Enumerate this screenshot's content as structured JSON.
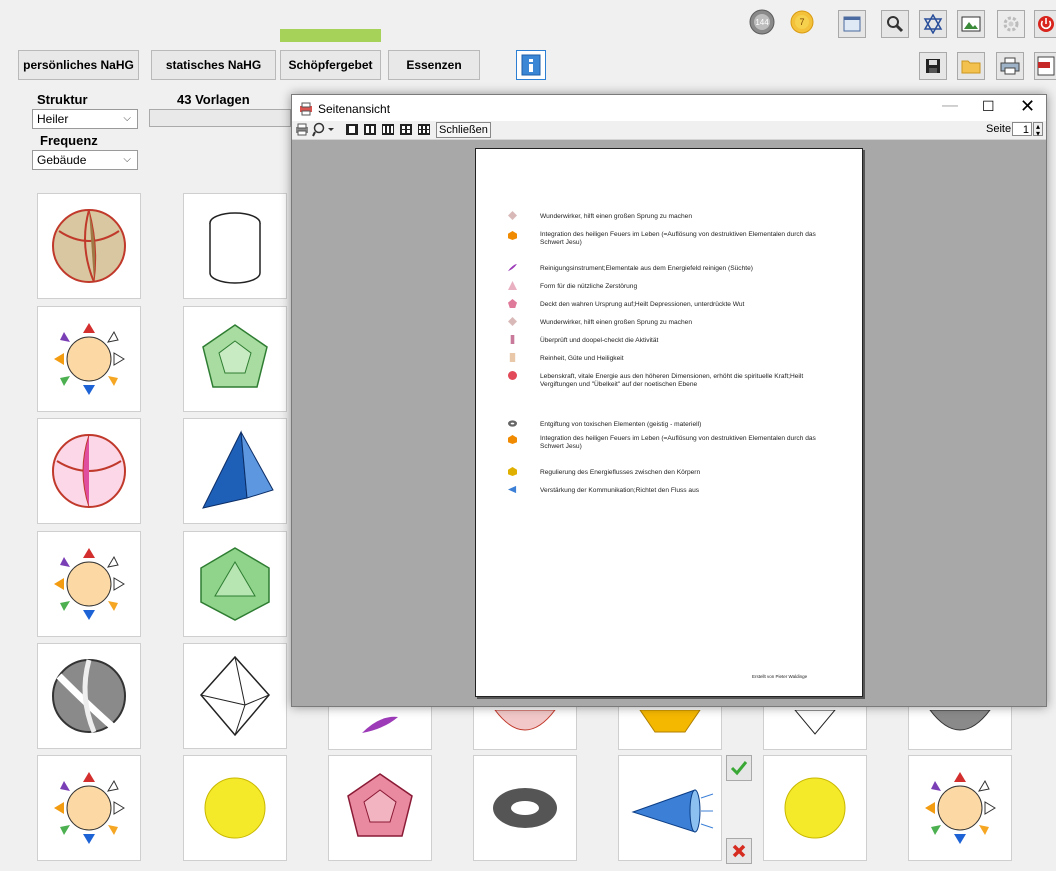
{
  "toolbar": {
    "buttons": [
      "persönliches NaHG",
      "statisches NaHG",
      "Schöpfergebet",
      "Essenzen"
    ],
    "info_icon": "info-icon",
    "badge_144": "144",
    "badge_7": "7"
  },
  "left_panel": {
    "struktur_label": "Struktur",
    "struktur_value": "Heiler",
    "frequenz_label": "Frequenz",
    "frequenz_value": "Gebäude",
    "vorlagen_label": "43 Vorlagen"
  },
  "dialog": {
    "title": "Seitenansicht",
    "close_label": "Schließen",
    "page_label": "Seite",
    "page_value": "1",
    "entries": [
      "Wunderwirker, hilft einen großen Sprung zu machen",
      "Integration des heiligen Feuers im Leben (=Auflösung von destruktiven Elementalen durch das Schwert Jesu)",
      "Reinigungsinstrument;Elementale aus dem Energiefeld reinigen (Süchte)",
      "Form für die nützliche Zerstörung",
      "Deckt den wahren Ursprung auf;Heilt Depressionen, unterdrückte Wut",
      "Wunderwirker, hilft einen großen Sprung zu machen",
      "Überprüft und doopel-checkt die Aktivität",
      "Reinheit, Güte und Heiligkeit",
      "Lebenskraft, vitale Energie aus den höheren Dimensionen, erhöht die spirituelle Kraft;Heilt Vergiftungen und \"Übelkeit\" auf der noetischen Ebene",
      "Entgiftung von toxischen Elementen (geistig - materiell)",
      "Integration des heiligen Feuers im Leben (=Auflösung von destruktiven Elementalen durch das Schwert Jesu)",
      "Regulierung des Energieflusses zwischen den Körpern",
      "Verstärkung der Kommunikation;Richtet den Fluss aus"
    ],
    "footer": "Erstellt von Pieter Waldinge"
  }
}
